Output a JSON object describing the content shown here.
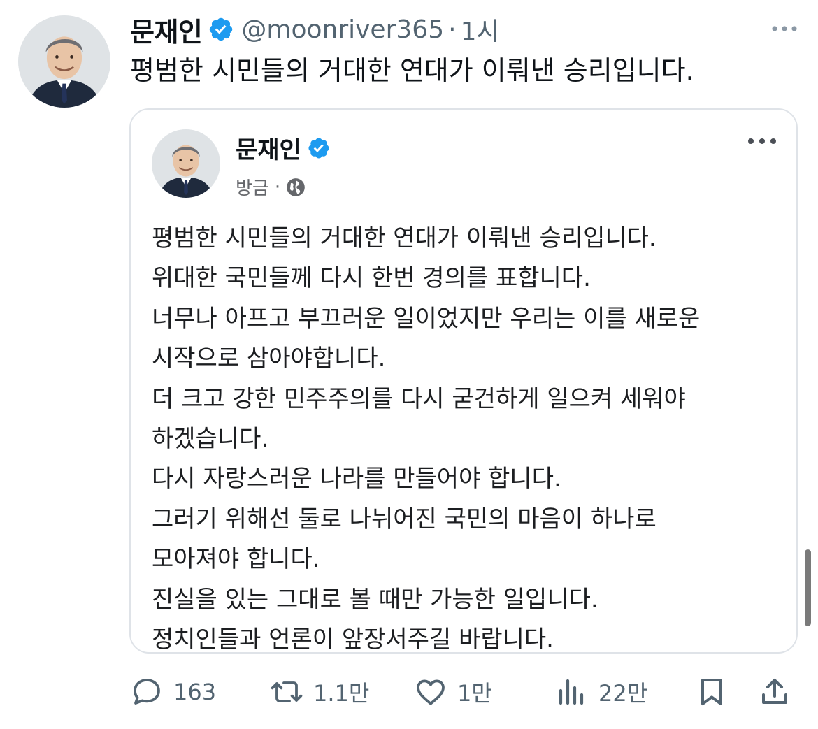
{
  "tweet": {
    "author_name": "문재인",
    "handle": "@moonriver365",
    "separator": "·",
    "timestamp": "1시",
    "text": "평범한 시민들의 거대한 연대가 이뤄낸 승리입니다."
  },
  "embedded_post": {
    "author_name": "문재인",
    "time": "방금",
    "separator": "·",
    "lines": [
      "평범한 시민들의 거대한 연대가 이뤄낸 승리입니다.",
      "위대한 국민들께 다시 한번 경의를 표합니다.",
      "너무나 아프고 부끄러운 일이었지만 우리는 이를 새로운",
      "시작으로 삼아야합니다.",
      "더 크고 강한 민주주의를 다시 굳건하게 일으켜 세워야",
      "하겠습니다.",
      "다시 자랑스러운 나라를 만들어야 합니다.",
      "그러기 위해선 둘로 나뉘어진 국민의 마음이 하나로",
      "모아져야 합니다.",
      "진실을 있는 그대로 볼 때만 가능한 일입니다.",
      "정치인들과 언론이 앞장서주길 바랍니다."
    ]
  },
  "actions": {
    "replies": "163",
    "reposts": "1.1만",
    "likes": "1만",
    "views": "22만"
  },
  "icons": {
    "verified": "verified-badge-icon",
    "more": "more-horizontal-icon",
    "globe": "globe-icon",
    "reply": "reply-icon",
    "repost": "repost-icon",
    "like": "heart-icon",
    "views": "views-icon",
    "bookmark": "bookmark-icon",
    "share": "share-icon"
  },
  "colors": {
    "verified_blue": "#1d9bf0",
    "text_primary": "#0f1419",
    "text_secondary": "#536471",
    "card_border": "#dfe3e8"
  }
}
